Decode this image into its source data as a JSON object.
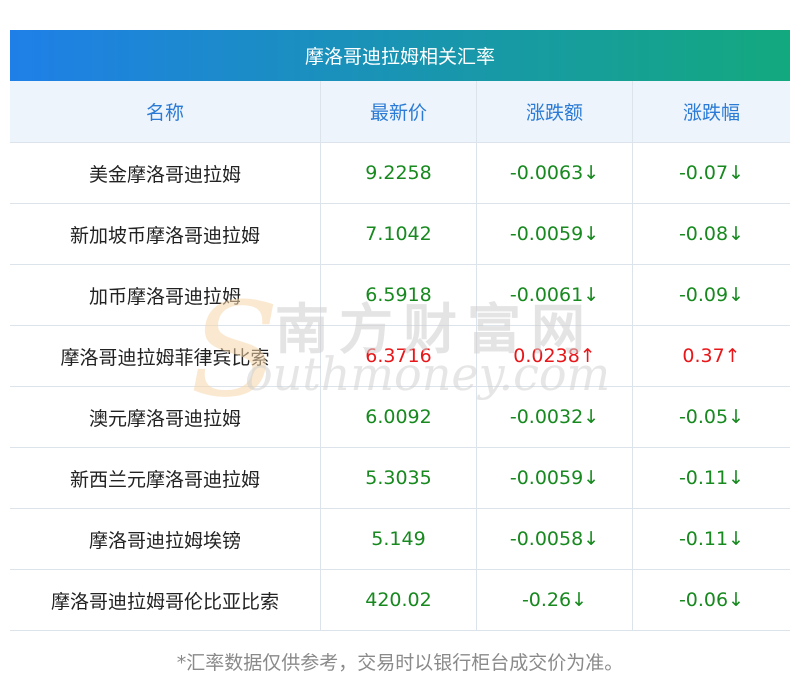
{
  "table": {
    "title": "摩洛哥迪拉姆相关汇率",
    "headers": [
      "名称",
      "最新价",
      "涨跌额",
      "涨跌幅"
    ],
    "rows": [
      {
        "name": "美金摩洛哥迪拉姆",
        "price": "9.2258",
        "change": "-0.0063↓",
        "pct": "-0.07↓",
        "dir": "down"
      },
      {
        "name": "新加坡币摩洛哥迪拉姆",
        "price": "7.1042",
        "change": "-0.0059↓",
        "pct": "-0.08↓",
        "dir": "down"
      },
      {
        "name": "加币摩洛哥迪拉姆",
        "price": "6.5918",
        "change": "-0.0061↓",
        "pct": "-0.09↓",
        "dir": "down"
      },
      {
        "name": "摩洛哥迪拉姆菲律宾比索",
        "price": "6.3716",
        "change": "0.0238↑",
        "pct": "0.37↑",
        "dir": "up"
      },
      {
        "name": "澳元摩洛哥迪拉姆",
        "price": "6.0092",
        "change": "-0.0032↓",
        "pct": "-0.05↓",
        "dir": "down"
      },
      {
        "name": "新西兰元摩洛哥迪拉姆",
        "price": "5.3035",
        "change": "-0.0059↓",
        "pct": "-0.11↓",
        "dir": "down"
      },
      {
        "name": "摩洛哥迪拉姆埃镑",
        "price": "5.149",
        "change": "-0.0058↓",
        "pct": "-0.11↓",
        "dir": "down"
      },
      {
        "name": "摩洛哥迪拉姆哥伦比亚比索",
        "price": "420.02",
        "change": "-0.26↓",
        "pct": "-0.06↓",
        "dir": "down"
      }
    ]
  },
  "footnote": "*汇率数据仅供参考，交易时以银行柜台成交价为准。",
  "watermark": {
    "cn": "南方财富网",
    "en": "outhmoney.com",
    "s": "S"
  },
  "colors": {
    "title_gradient_start": "#1f7fe8",
    "title_gradient_end": "#13a97e",
    "header_text": "#2b7bd6",
    "down": "#17891f",
    "up": "#e8171a"
  }
}
